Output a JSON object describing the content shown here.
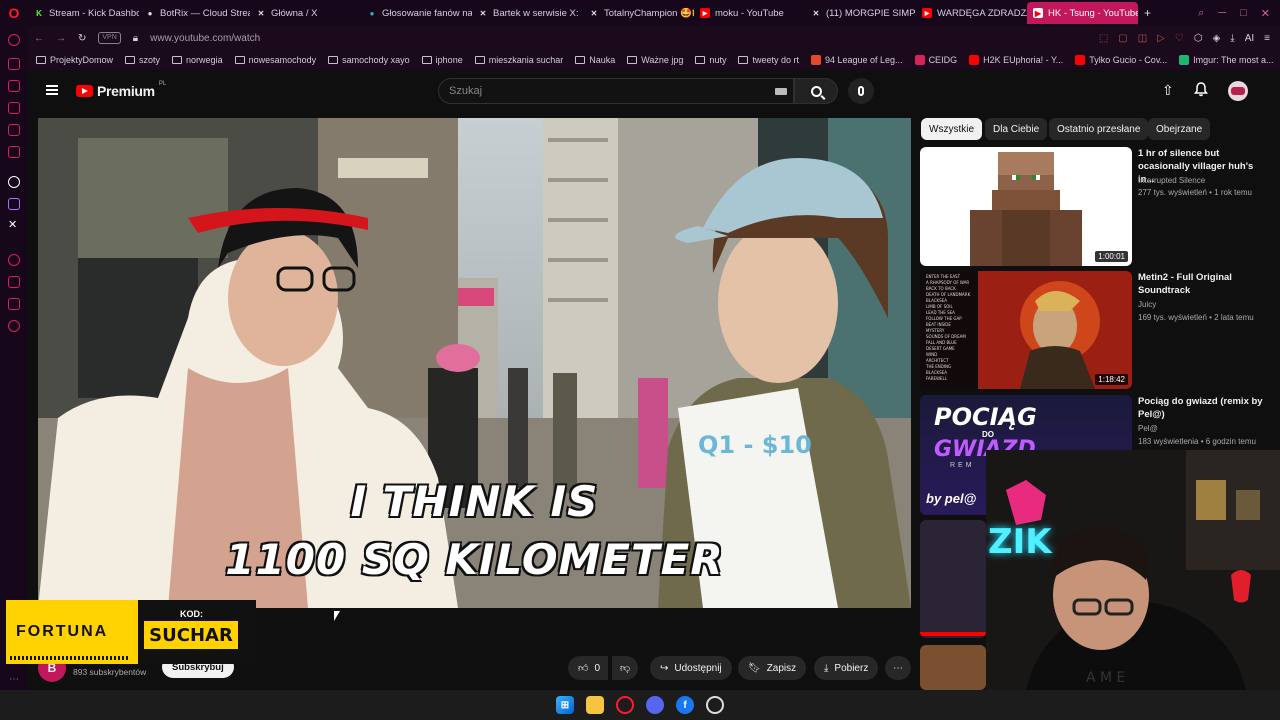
{
  "browser": {
    "tabs": [
      {
        "label": "Stream - Kick Dashbo",
        "favicon": "kick-icon",
        "color": "#53fc18"
      },
      {
        "label": "BotRix — Cloud Strea",
        "favicon": "botrix-icon",
        "color": "#dddddd"
      },
      {
        "label": "Główna / X",
        "favicon": "x-icon",
        "color": "#dddddd"
      },
      {
        "label": "Głosowanie fanów na",
        "favicon": "globe-icon",
        "color": "#2bb0c9"
      },
      {
        "label": "Bartek w serwisie X:",
        "favicon": "x-icon",
        "color": "#dddddd"
      },
      {
        "label": "TotalnyChampion 🤩🎁",
        "favicon": "x-icon",
        "color": "#dddddd"
      },
      {
        "label": "moku - YouTube",
        "favicon": "youtube-icon",
        "color": "#ff0000"
      },
      {
        "label": "(11) MORGPIE SIMP w",
        "favicon": "x-icon",
        "color": "#dddddd"
      },
      {
        "label": "WARDĘGA ZDRADZA",
        "favicon": "youtube-icon",
        "color": "#ff0000"
      },
      {
        "label": "HK - Tsung - YouTube",
        "favicon": "youtube-icon",
        "color": "#ff0000",
        "active": true
      }
    ],
    "new_tab": "+",
    "url": "www.youtube.com/watch",
    "vpn_badge": "VPN",
    "ai_label": "AI",
    "bookmarks": [
      {
        "label": "ProjektyDomow",
        "icon": "folder-icon"
      },
      {
        "label": "szoty",
        "icon": "folder-icon"
      },
      {
        "label": "norwegia",
        "icon": "folder-icon"
      },
      {
        "label": "nowesamochody",
        "icon": "folder-icon"
      },
      {
        "label": "samochody xayo",
        "icon": "folder-icon"
      },
      {
        "label": "iphone",
        "icon": "folder-icon"
      },
      {
        "label": "mieszkania suchar",
        "icon": "folder-icon"
      },
      {
        "label": "Nauka",
        "icon": "folder-icon"
      },
      {
        "label": "Ważne jpg",
        "icon": "folder-icon"
      },
      {
        "label": "nuty",
        "icon": "folder-icon"
      },
      {
        "label": "tweety do rt",
        "icon": "folder-icon"
      },
      {
        "label": "94 League of Leg...",
        "icon": "league-icon"
      },
      {
        "label": "CEIDG",
        "icon": "ceidg-icon"
      },
      {
        "label": "H2K EUphoria! - Y...",
        "icon": "youtube-icon"
      },
      {
        "label": "Tylko Gucio - Cov...",
        "icon": "youtube-icon"
      },
      {
        "label": "Imgur: The most a...",
        "icon": "imgur-icon"
      }
    ]
  },
  "youtube": {
    "brand": "Premium",
    "region": "PL",
    "search_placeholder": "Szukaj",
    "subtitle_line1": "I THINK IS",
    "subtitle_line2": "1100 SQ KILOMETER",
    "sign_text": "Q1 - $10",
    "chips": [
      "Wszystkie",
      "Dla Ciebie",
      "Ostatnio przesłane",
      "Obejrzane"
    ],
    "recommendations": [
      {
        "title": "1 hr of silence but ocasionally villager huh's in...",
        "channel": "Interrupted Silence",
        "meta": "277 tys. wyświetleń • 1 rok temu",
        "duration": "1:00:01"
      },
      {
        "title": "Metin2 - Full Original Soundtrack",
        "channel": "Juicy",
        "meta": "169 tys. wyświetleń • 2 lata temu",
        "duration": "1:18:42"
      },
      {
        "title": "Pociąg do gwiazd (remix by Pel@)",
        "channel": "Pel@",
        "meta": "183 wyświetlenia • 6 godzin temu",
        "duration": ""
      }
    ],
    "thumb3_text_line1": "POCIĄG",
    "thumb3_text_line2": "GWIAZD",
    "thumb3_small": "DO",
    "thumb3_sub": "REM",
    "thumb3_sig": "by pel@",
    "metin_tracklist": [
      "ENTER THE EAST",
      "A RHAPSODY OF WAR",
      "BACK TO BACK",
      "DEATH OF LANDMARK",
      "BLACKSEA",
      "LIMB OF SOIL",
      "LEAD THE SEA",
      "FOLLOW THE GAP",
      "BEAT INSIDE",
      "MYSTERY",
      "SOUNDS OF DREAM",
      "FALL AND BLUE",
      "DESERT GAME",
      "WIND",
      "ARCHITECT",
      "THE ENDING",
      "BLACKSEA",
      "FAREWELL"
    ],
    "channel_initial": "B",
    "subscribers": "893 subskrybentów",
    "subscribe_label": "Subskrybuj",
    "likes": "0",
    "share_label": "Udostępnij",
    "save_label": "Zapisz",
    "download_label": "Pobierz"
  },
  "overlays": {
    "fortuna_brand": "FORTUNA",
    "code_label": "KOD:",
    "code_value": "SUCHAR",
    "webcam_neon": "ZIK"
  },
  "colors": {
    "browser_accent": "#c2175b",
    "youtube_red": "#ff0000",
    "fortuna_yellow": "#ffd200"
  }
}
